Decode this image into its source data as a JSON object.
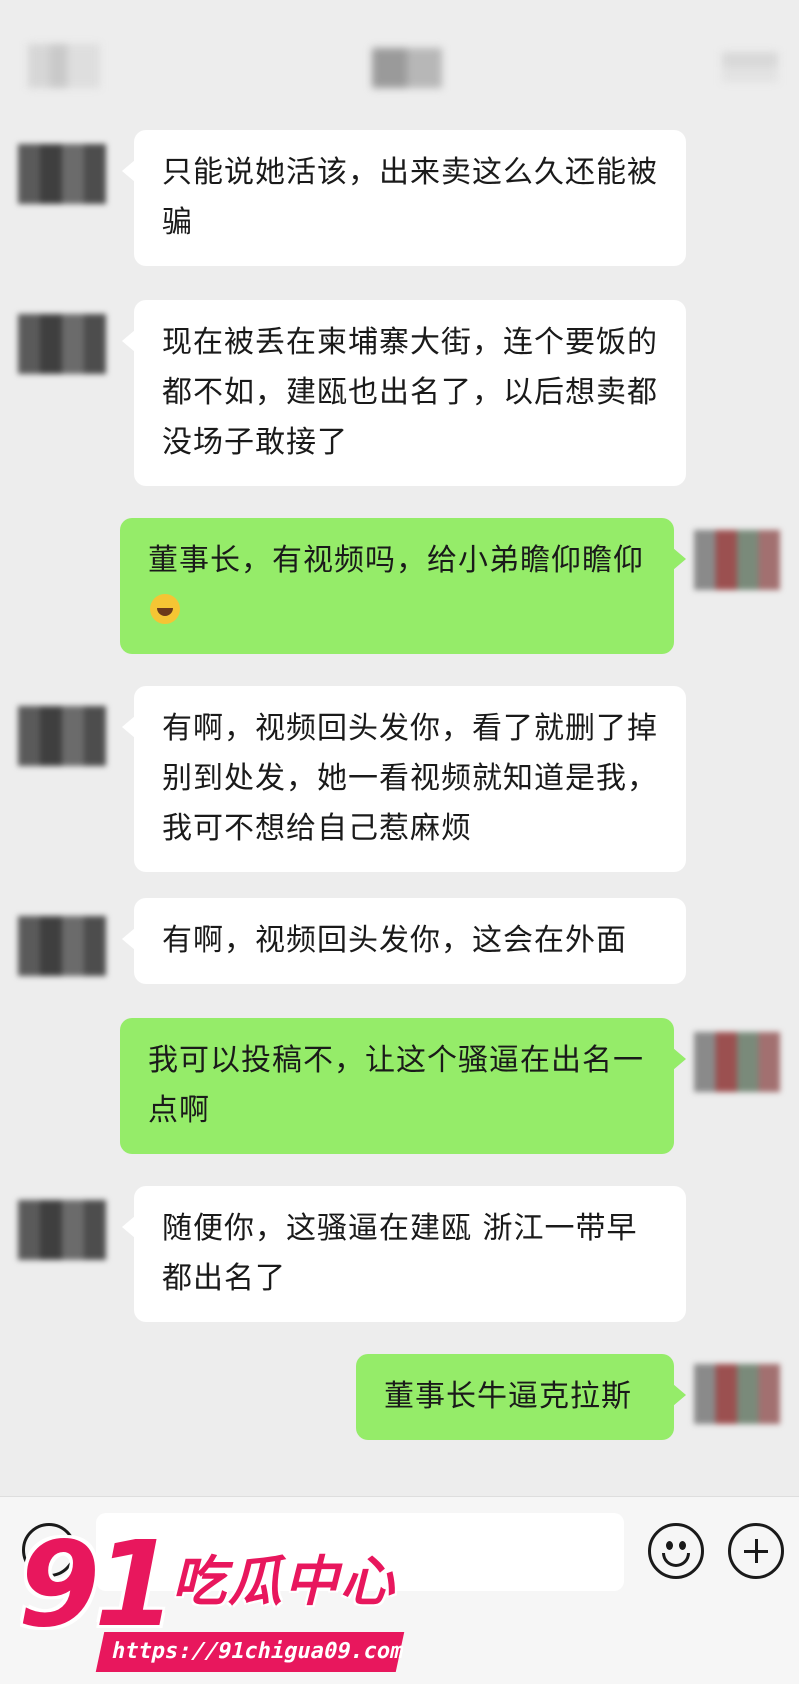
{
  "header": {
    "title": "",
    "left": "",
    "right": ""
  },
  "messages": [
    {
      "side": "left",
      "text": "只能说她活该，出来卖这么久还能被骗"
    },
    {
      "side": "left",
      "text": "现在被丢在柬埔寨大街，连个要饭的都不如，建瓯也出名了，以后想卖都没场子敢接了"
    },
    {
      "side": "right",
      "text": "董事长，有视频吗，给小弟瞻仰瞻仰",
      "emoji": "rofl-emoji"
    },
    {
      "side": "left",
      "text": "有啊，视频回头发你，看了就删了掉别到处发，她一看视频就知道是我，我可不想给自己惹麻烦"
    },
    {
      "side": "left",
      "text": "有啊，视频回头发你，这会在外面"
    },
    {
      "side": "right",
      "text": "我可以投稿不，让这个骚逼在出名一点啊"
    },
    {
      "side": "left",
      "text": "随便你，这骚逼在建瓯 浙江一带早都出名了"
    },
    {
      "side": "right",
      "text": "董事长牛逼克拉斯"
    }
  ],
  "inputbar": {
    "voice_icon": "voice-icon",
    "emoji_icon": "smile-icon",
    "plus_icon": "plus-icon"
  },
  "watermark": {
    "number": "91",
    "name": "吃瓜中心",
    "url": "https://91chigua09.com"
  },
  "colors": {
    "background": "#ededed",
    "bubble_self": "#95ec69",
    "bubble_other": "#ffffff",
    "watermark": "#e8175d"
  }
}
